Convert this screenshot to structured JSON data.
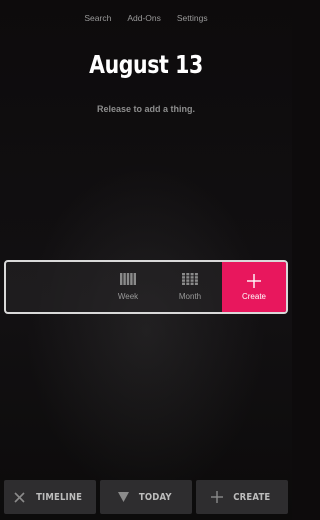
{
  "top_nav": {
    "items": [
      "Search",
      "Add-Ons",
      "Settings"
    ]
  },
  "date_title": "August 13",
  "hint": "Release to add a thing.",
  "panel": {
    "week_label": "Week",
    "month_label": "Month",
    "create_label": "Create",
    "create_color": "#e8175d"
  },
  "bottom_bar": {
    "timeline_label": "TIMELINE",
    "today_label": "TODAY",
    "create_label": "CREATE"
  },
  "icons": {
    "timeline": "close-x-icon",
    "today": "triangle-down-icon",
    "create": "plus-icon",
    "week": "week-grid-icon",
    "month": "month-grid-icon"
  }
}
